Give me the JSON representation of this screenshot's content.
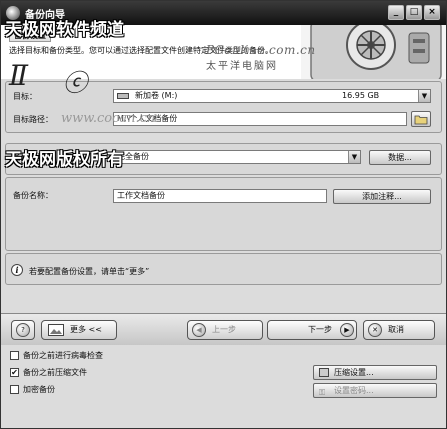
{
  "window": {
    "title": "备份向导",
    "min_label": "_",
    "max_label": "□",
    "close_label": "×"
  },
  "header": {
    "section_title": "备份设置",
    "description": "选择目标和备份类型。您可以通过选择配置文件创建特定文件类型的备份。",
    "brand": "PConline.com.cn",
    "brand_cn": "太平洋电脑网"
  },
  "watermarks": {
    "top": "天极网软件频道",
    "middle": "天极网版权所有",
    "www": "www.cocan.cn"
  },
  "target": {
    "label": "目标：",
    "drive_name": "新加卷 (M:)",
    "drive_size": "16.95 GB",
    "path_label": "目标路径：",
    "path_value": "M:\\个人文档备份"
  },
  "backup_type": {
    "label": "备份类型：",
    "value": "完全备份",
    "data_button": "数据..."
  },
  "backup_name": {
    "label": "备份名称：",
    "value": "工作文档备份",
    "comment_button": "添加注释..."
  },
  "tip": {
    "icon": "info-icon",
    "text": "若要配置备份设置，请单击“更多”"
  },
  "nav": {
    "more_label": "更多 <<",
    "back_label": "上一步",
    "next_label": "下一步",
    "cancel_label": "取消"
  },
  "options": {
    "virus_check": {
      "label": "备份之前进行病毒检查",
      "checked": false
    },
    "compress": {
      "label": "备份之前压缩文件",
      "checked": true
    },
    "encrypt": {
      "label": "加密备份",
      "checked": false
    },
    "compress_settings": "压缩设置...",
    "password_settings": "设置密码..."
  },
  "colors": {
    "titlebar": "#222222",
    "panel": "#d8d8d8",
    "background": "#dcdcdc"
  }
}
